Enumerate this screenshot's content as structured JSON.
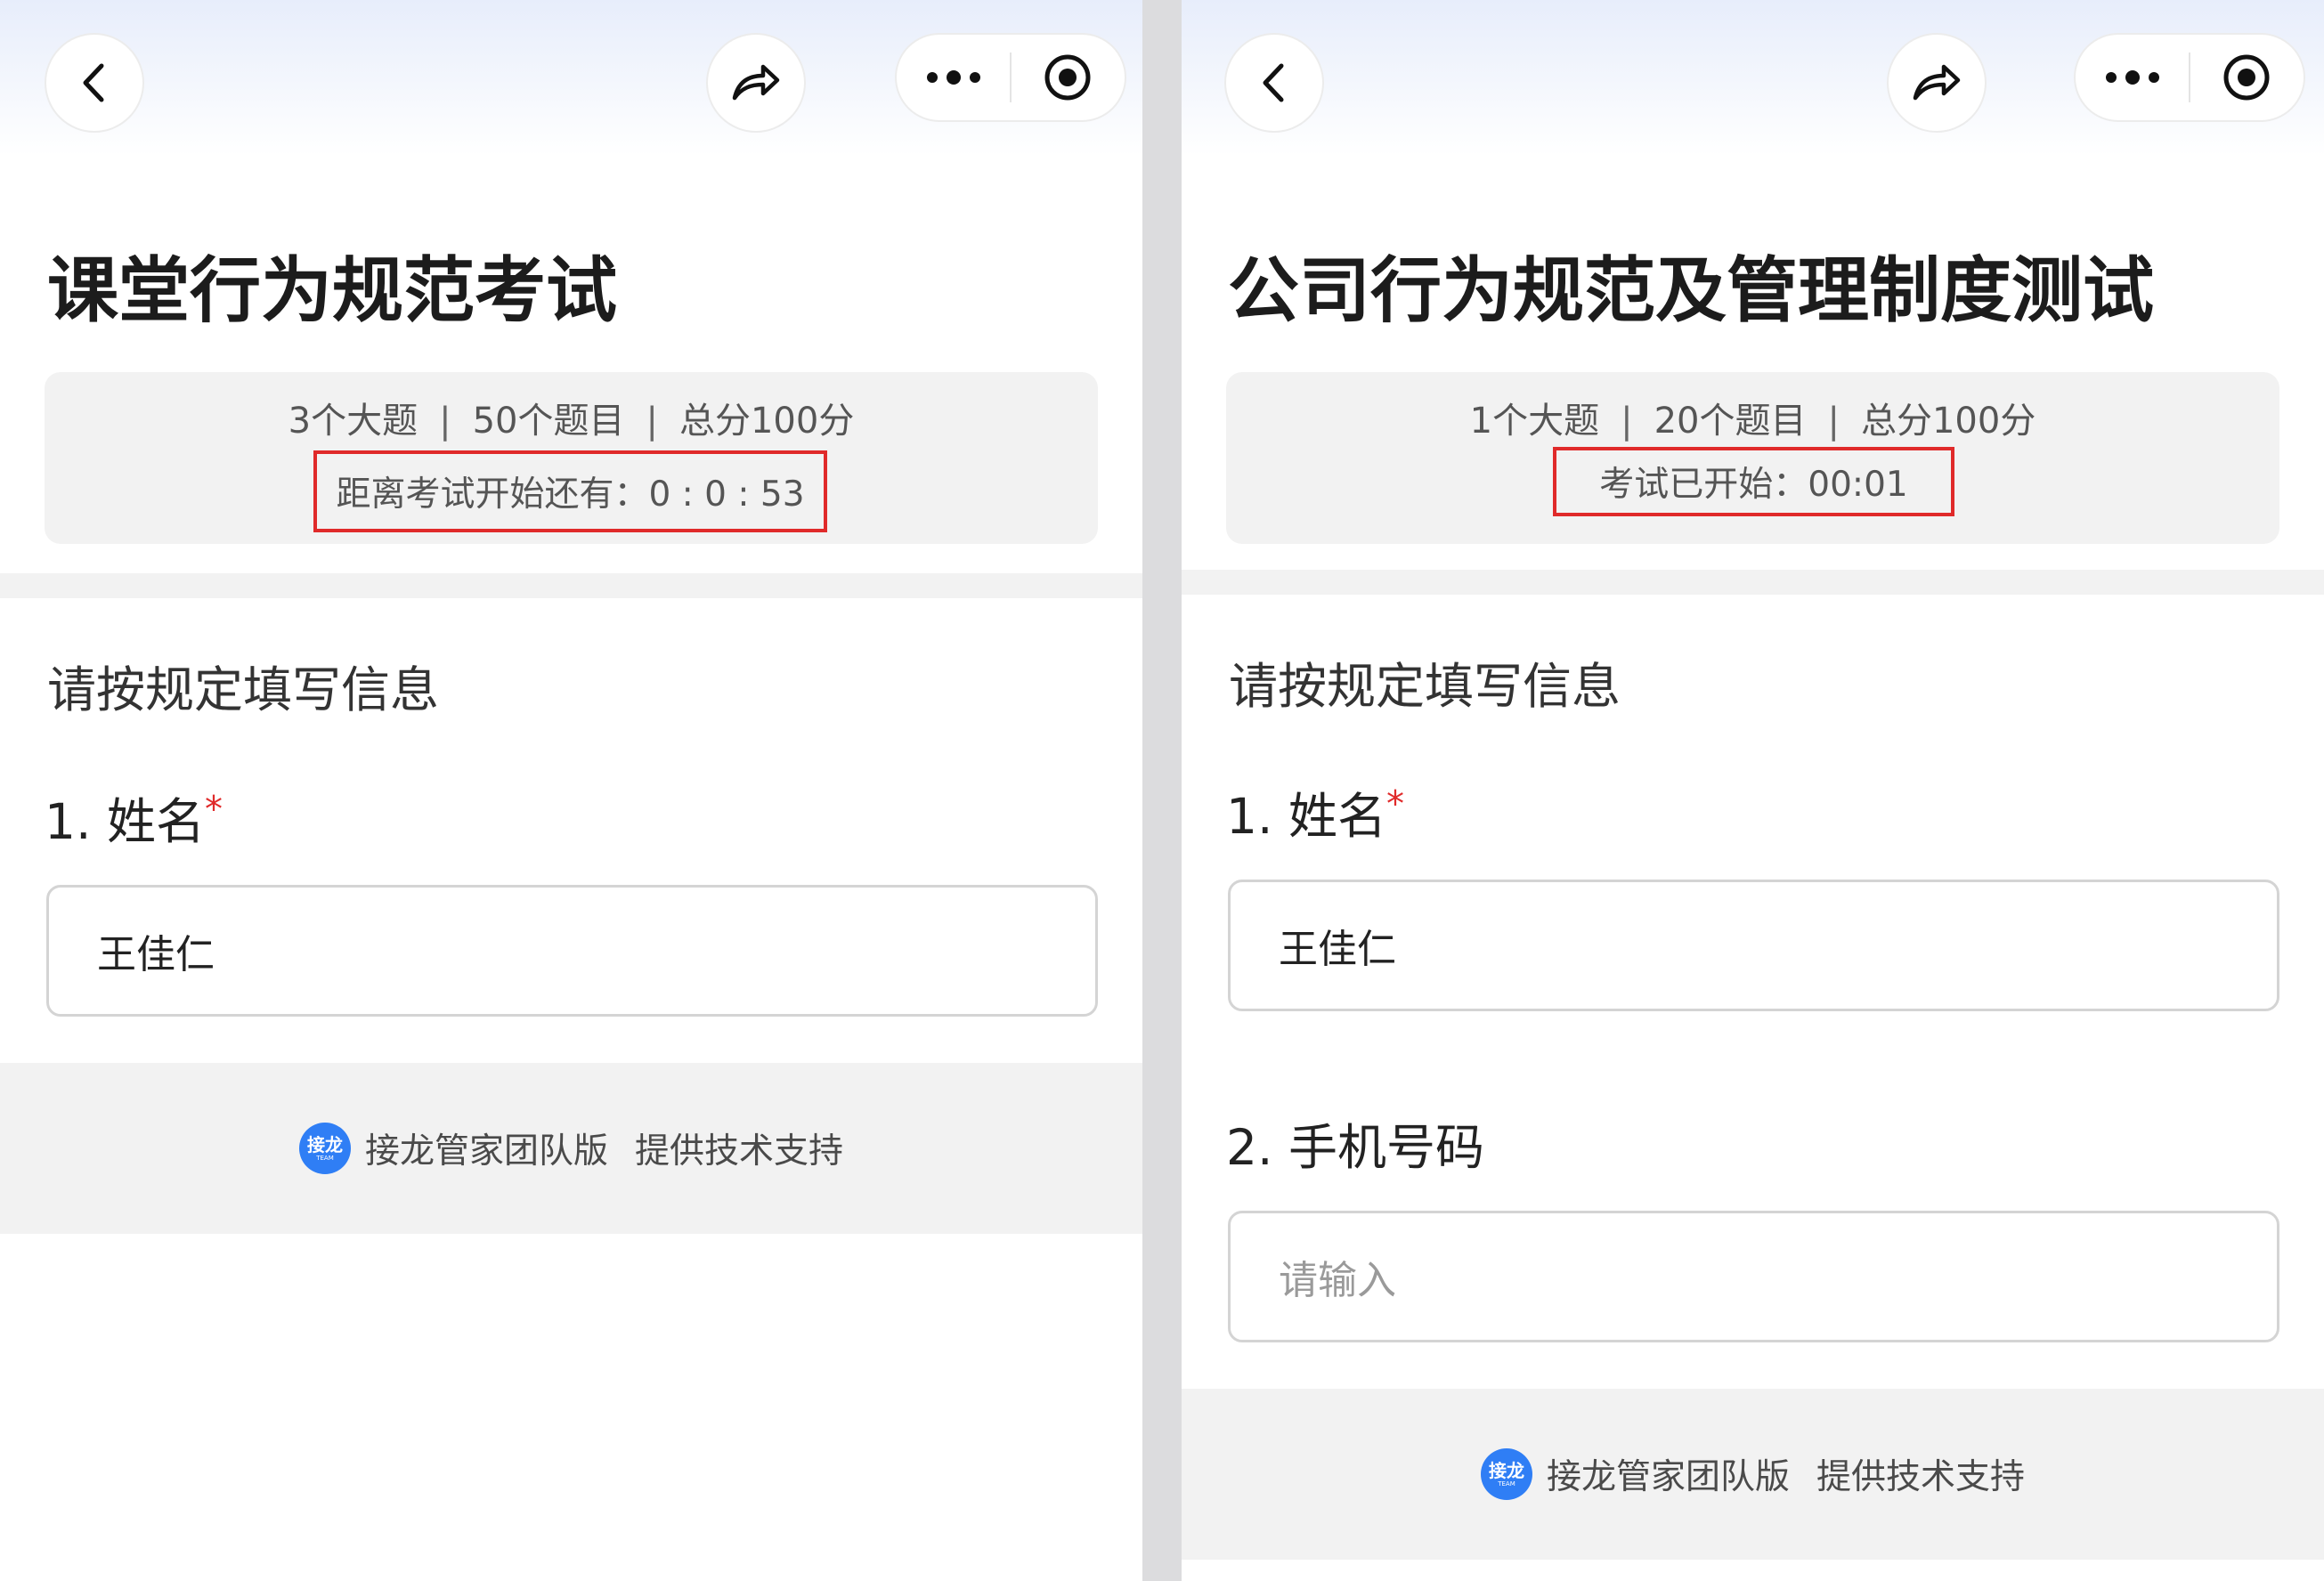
{
  "left": {
    "title": "课堂行为规范考试",
    "stats": {
      "sections": "3个大题",
      "questions": "50个题目",
      "total": "总分100分",
      "separator": "|"
    },
    "countdown": "距离考试开始还有：0 : 0 : 53",
    "form_heading": "请按规定填写信息",
    "q1": {
      "label": "1. 姓名",
      "required_mark": "*",
      "value": "王佳仁"
    },
    "footer": {
      "logo_text": "接龙",
      "logo_sub": "TEAM",
      "brand": "接龙管家团队版",
      "support": "提供技术支持"
    }
  },
  "right": {
    "title": "公司行为规范及管理制度测试",
    "stats": {
      "sections": "1个大题",
      "questions": "20个题目",
      "total": "总分100分",
      "separator": "|"
    },
    "status": "考试已开始：00:01",
    "form_heading": "请按规定填写信息",
    "q1": {
      "label": "1. 姓名",
      "required_mark": "*",
      "value": "王佳仁"
    },
    "q2": {
      "label": "2. 手机号码",
      "placeholder": "请输入"
    },
    "footer": {
      "logo_text": "接龙",
      "logo_sub": "TEAM",
      "brand": "接龙管家团队版",
      "support": "提供技术支持"
    }
  },
  "icons": [
    "back-icon",
    "share-icon",
    "more-dots-icon",
    "record-target-icon",
    "jielong-logo-icon"
  ],
  "colors": {
    "highlight_border": "#e02a2a",
    "required": "#e02a2a",
    "logo": "#2f7ef5",
    "info_bg": "#f2f2f2"
  }
}
